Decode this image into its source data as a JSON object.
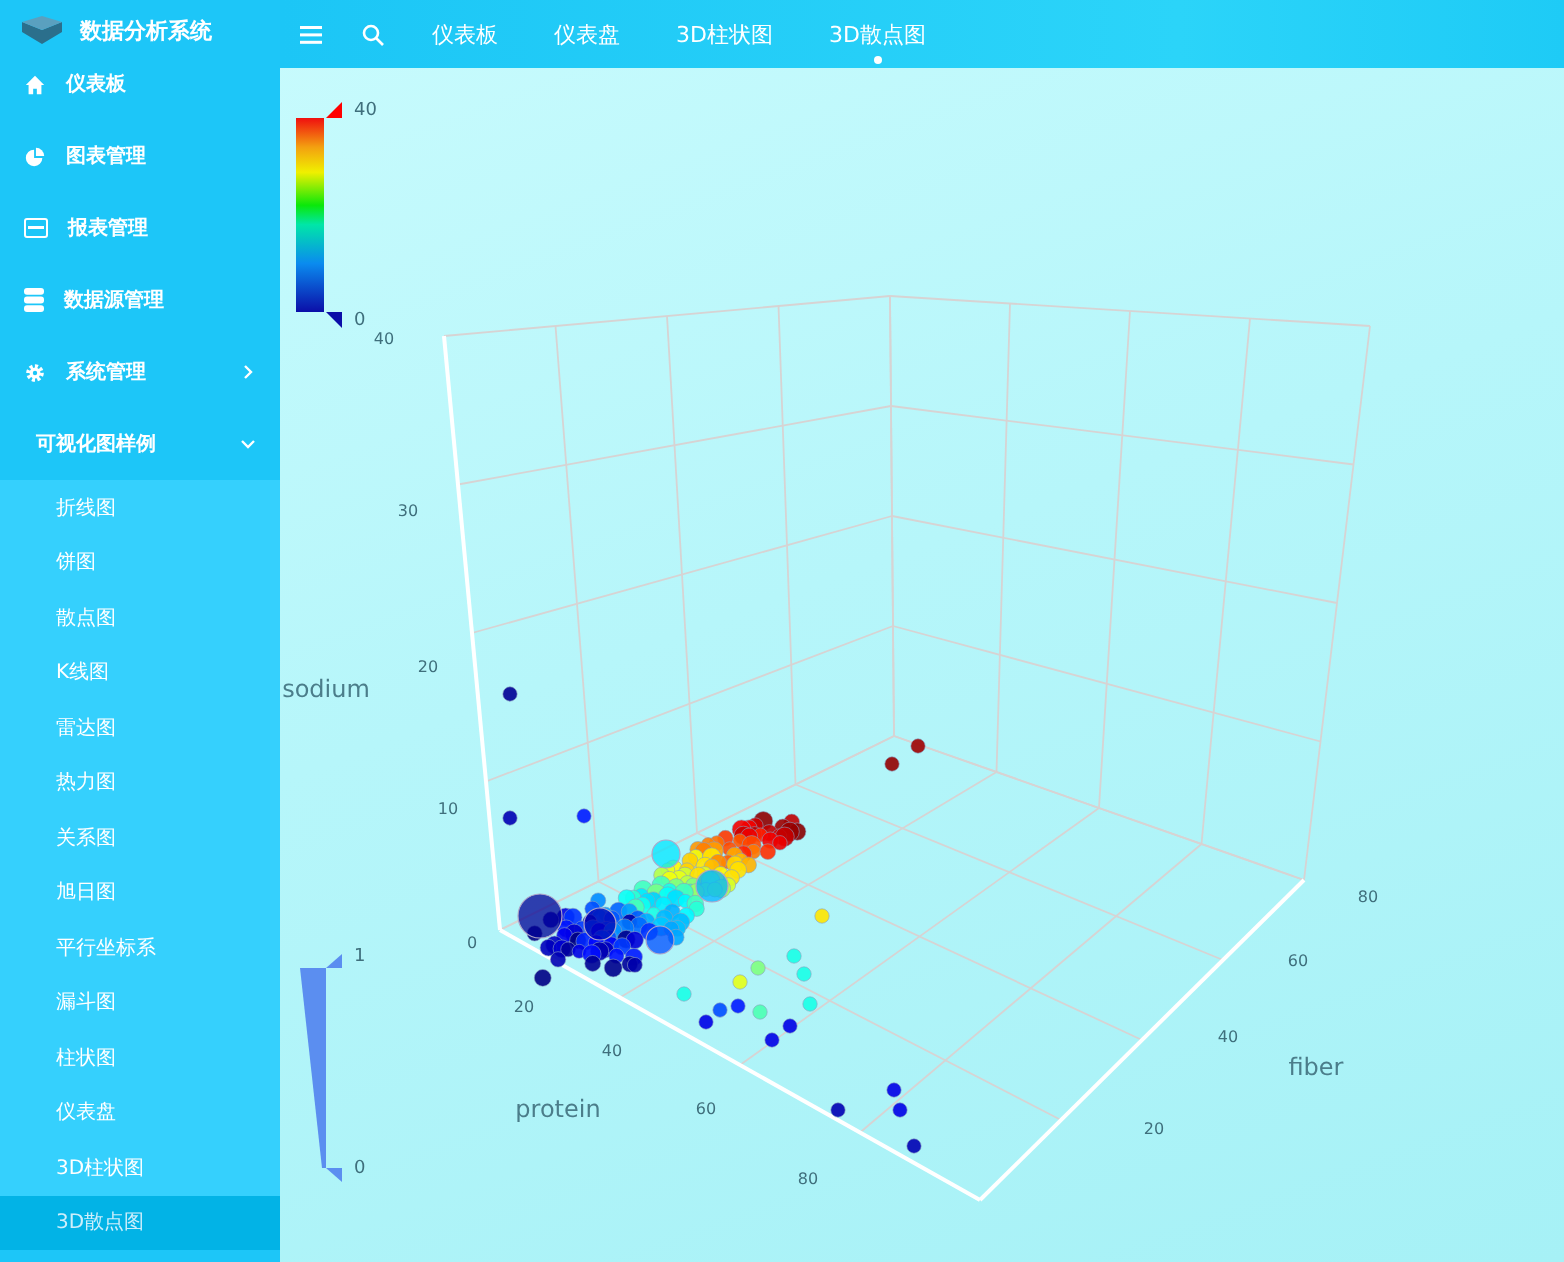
{
  "app": {
    "title": "数据分析系统"
  },
  "topbar": {
    "tabs": [
      {
        "label": "仪表板",
        "selected": false
      },
      {
        "label": "仪表盘",
        "selected": false
      },
      {
        "label": "3D柱状图",
        "selected": false
      },
      {
        "label": "3D散点图",
        "selected": true
      }
    ]
  },
  "sidebar": {
    "items": [
      {
        "label": "仪表板"
      },
      {
        "label": "图表管理"
      },
      {
        "label": "报表管理"
      },
      {
        "label": "数据源管理"
      },
      {
        "label": "系统管理",
        "expanded": false
      },
      {
        "label": "可视化图样例",
        "expanded": true,
        "children": [
          {
            "label": "折线图",
            "selected": false
          },
          {
            "label": "饼图",
            "selected": false
          },
          {
            "label": "散点图",
            "selected": false
          },
          {
            "label": "K线图",
            "selected": false
          },
          {
            "label": "雷达图",
            "selected": false
          },
          {
            "label": "热力图",
            "selected": false
          },
          {
            "label": "关系图",
            "selected": false
          },
          {
            "label": "旭日图",
            "selected": false
          },
          {
            "label": "平行坐标系",
            "selected": false
          },
          {
            "label": "漏斗图",
            "selected": false
          },
          {
            "label": "柱状图",
            "selected": false
          },
          {
            "label": "仪表盘",
            "selected": false
          },
          {
            "label": "3D柱状图",
            "selected": false
          },
          {
            "label": "3D散点图",
            "selected": true
          }
        ]
      }
    ]
  },
  "chart": {
    "color_scale": {
      "max": "40",
      "min": "0"
    },
    "size_scale": {
      "max": "1",
      "min": "0"
    },
    "axes": [
      {
        "name": "sodium",
        "ticks": [
          "0",
          "10",
          "20",
          "30",
          "40"
        ]
      },
      {
        "name": "protein",
        "ticks": [
          "20",
          "40",
          "60",
          "80"
        ]
      },
      {
        "name": "fiber",
        "ticks": [
          "20",
          "40",
          "60",
          "80"
        ]
      }
    ]
  }
}
